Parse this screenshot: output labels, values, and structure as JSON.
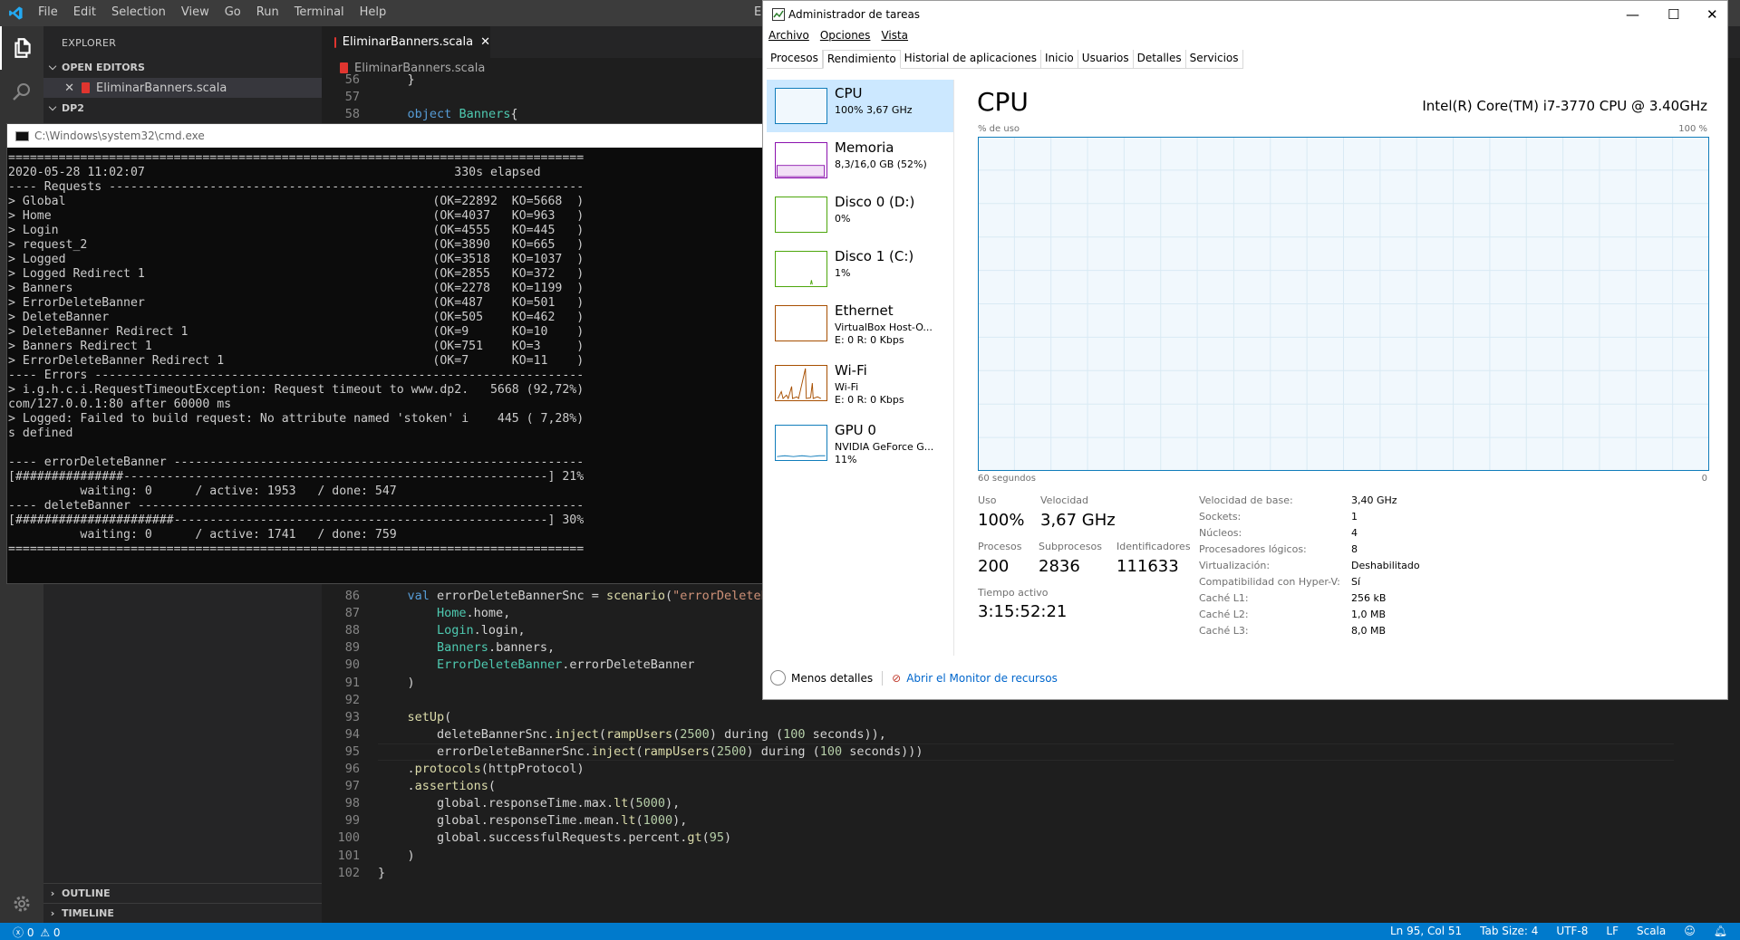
{
  "vscode": {
    "menu": [
      "File",
      "Edit",
      "Selection",
      "View",
      "Go",
      "Run",
      "Terminal",
      "Help"
    ],
    "explorer_title": "EXPLORER",
    "open_editors_label": "OPEN EDITORS",
    "open_file": "EliminarBanners.scala",
    "folder_label": "DP2",
    "outline_label": "OUTLINE",
    "timeline_label": "TIMELINE",
    "tab_label": "EliminarBanners.scala",
    "breadcrumb": "EliminarBanners.scala",
    "title_fragment": "E",
    "code_top": [
      {
        "n": "56",
        "code": "    }"
      },
      {
        "n": "57",
        "code": ""
      },
      {
        "n": "58",
        "code": "    object Banners{"
      }
    ],
    "code_bottom": [
      {
        "n": "86",
        "code": "    val errorDeleteBannerSnc = scenario(\"errorDeleteBa"
      },
      {
        "n": "87",
        "code": "        Home.home,"
      },
      {
        "n": "88",
        "code": "        Login.login,"
      },
      {
        "n": "89",
        "code": "        Banners.banners,"
      },
      {
        "n": "90",
        "code": "        ErrorDeleteBanner.errorDeleteBanner"
      },
      {
        "n": "91",
        "code": "    )"
      },
      {
        "n": "92",
        "code": ""
      },
      {
        "n": "93",
        "code": "    setUp("
      },
      {
        "n": "94",
        "code": "        deleteBannerSnc.inject(rampUsers(2500) during (100 seconds)),"
      },
      {
        "n": "95",
        "code": "        errorDeleteBannerSnc.inject(rampUsers(2500) during (100 seconds)))"
      },
      {
        "n": "96",
        "code": "    .protocols(httpProtocol)"
      },
      {
        "n": "97",
        "code": "    .assertions("
      },
      {
        "n": "98",
        "code": "        global.responseTime.max.lt(5000),"
      },
      {
        "n": "99",
        "code": "        global.responseTime.mean.lt(1000),"
      },
      {
        "n": "100",
        "code": "        global.successfulRequests.percent.gt(95)"
      },
      {
        "n": "101",
        "code": "    )"
      },
      {
        "n": "102",
        "code": "}"
      }
    ],
    "status": {
      "errors": "0",
      "warnings": "0",
      "position": "Ln 95, Col 51",
      "tab_size": "Tab Size: 4",
      "encoding": "UTF-8",
      "eol": "LF",
      "language": "Scala"
    }
  },
  "cmd": {
    "title": "C:\\Windows\\system32\\cmd.exe",
    "lines": [
      "================================================================================",
      "2020-05-28 11:02:07                                           330s elapsed",
      "---- Requests ------------------------------------------------------------------",
      "> Global                                                   (OK=22892  KO=5668  )",
      "> Home                                                     (OK=4037   KO=963   )",
      "> Login                                                    (OK=4555   KO=445   )",
      "> request_2                                                (OK=3890   KO=665   )",
      "> Logged                                                   (OK=3518   KO=1037  )",
      "> Logged Redirect 1                                        (OK=2855   KO=372   )",
      "> Banners                                                  (OK=2278   KO=1199  )",
      "> ErrorDeleteBanner                                        (OK=487    KO=501   )",
      "> DeleteBanner                                             (OK=505    KO=462   )",
      "> DeleteBanner Redirect 1                                  (OK=9      KO=10    )",
      "> Banners Redirect 1                                       (OK=751    KO=3     )",
      "> ErrorDeleteBanner Redirect 1                             (OK=7      KO=11    )",
      "---- Errors --------------------------------------------------------------------",
      "> i.g.h.c.i.RequestTimeoutException: Request timeout to www.dp2.   5668 (92,72%)",
      "com/127.0.0.1:80 after 60000 ms",
      "> Logged: Failed to build request: No attribute named 'stoken' i    445 ( 7,28%)",
      "s defined",
      "",
      "---- errorDeleteBanner ---------------------------------------------------------",
      "[###############-----------------------------------------------------------] 21%",
      "          waiting: 0      / active: 1953   / done: 547",
      "---- deleteBanner --------------------------------------------------------------",
      "[######################----------------------------------------------------] 30%",
      "          waiting: 0      / active: 1741   / done: 759",
      "================================================================================"
    ]
  },
  "taskmgr": {
    "title": "Administrador de tareas",
    "menu": [
      "Archivo",
      "Opciones",
      "Vista"
    ],
    "tabs": [
      "Procesos",
      "Rendimiento",
      "Historial de aplicaciones",
      "Inicio",
      "Usuarios",
      "Detalles",
      "Servicios"
    ],
    "selected_tab": "Rendimiento",
    "resources": [
      {
        "name": "CPU",
        "sub1": "100% 3,67 GHz",
        "sub2": "",
        "color": "#117dbb"
      },
      {
        "name": "Memoria",
        "sub1": "8,3/16,0 GB (52%)",
        "sub2": "",
        "color": "#8b12ae"
      },
      {
        "name": "Disco 0 (D:)",
        "sub1": "0%",
        "sub2": "",
        "color": "#4da60c"
      },
      {
        "name": "Disco 1 (C:)",
        "sub1": "1%",
        "sub2": "",
        "color": "#4da60c"
      },
      {
        "name": "Ethernet",
        "sub1": "VirtualBox Host-O...",
        "sub2": "E: 0 R: 0 Kbps",
        "color": "#a74f01"
      },
      {
        "name": "Wi-Fi",
        "sub1": "Wi-Fi",
        "sub2": "E: 0 R: 0 Kbps",
        "color": "#a74f01"
      },
      {
        "name": "GPU 0",
        "sub1": "NVIDIA GeForce G...",
        "sub2": "11%",
        "color": "#117dbb"
      }
    ],
    "cpu": {
      "heading": "CPU",
      "model": "Intel(R) Core(TM) i7-3770 CPU @ 3.40GHz",
      "graph_label_left": "% de uso",
      "graph_label_right": "100 %",
      "graph_time": "60 segundos",
      "graph_zero": "0",
      "stats": {
        "uso_label": "Uso",
        "uso": "100%",
        "velocidad_label": "Velocidad",
        "velocidad": "3,67 GHz",
        "procesos_label": "Procesos",
        "procesos": "200",
        "subprocesos_label": "Subprocesos",
        "subprocesos": "2836",
        "identificadores_label": "Identificadores",
        "identificadores": "111633",
        "tiempo_label": "Tiempo activo",
        "tiempo": "3:15:52:21"
      },
      "props": [
        {
          "k": "Velocidad de base:",
          "v": "3,40 GHz"
        },
        {
          "k": "Sockets:",
          "v": "1"
        },
        {
          "k": "Núcleos:",
          "v": "4"
        },
        {
          "k": "Procesadores lógicos:",
          "v": "8"
        },
        {
          "k": "Virtualización:",
          "v": "Deshabilitado"
        },
        {
          "k": "Compatibilidad con Hyper-V:",
          "v": "Sí"
        },
        {
          "k": "Caché L1:",
          "v": "256 kB"
        },
        {
          "k": "Caché L2:",
          "v": "1,0 MB"
        },
        {
          "k": "Caché L3:",
          "v": "8,0 MB"
        }
      ]
    },
    "footer": {
      "fewer_details": "Menos detalles",
      "resource_monitor": "Abrir el Monitor de recursos"
    }
  },
  "colors": {
    "vscode_status": "#007acc",
    "tm_cpu": "#117dbb",
    "selected_row": "#cce8ff"
  }
}
